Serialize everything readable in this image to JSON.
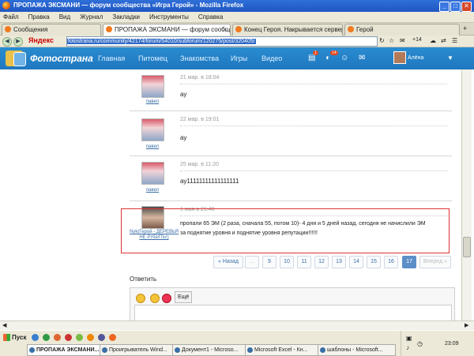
{
  "window": {
    "title": "ПРОПАЖА ЭКСМАНИ — форум сообщества «Игра Герой» - Mozilla Firefox",
    "min": "_",
    "max": "□",
    "close": "✕"
  },
  "menu": [
    "Файл",
    "Правка",
    "Вид",
    "Журнал",
    "Закладки",
    "Инструменты",
    "Справка"
  ],
  "tabs": [
    {
      "label": "Сообщения",
      "active": false
    },
    {
      "label": "ПРОПАЖА ЭКСМАНИ — форум сообще...",
      "active": true
    },
    {
      "label": "Конец Героя. Накрывается сервер —...",
      "active": false
    },
    {
      "label": "Герой",
      "active": false
    }
  ],
  "navbar": {
    "yandex": "Яндекс",
    "url_host": "fotostrana.ru",
    "url_path": "/community/42174/forum/54010/subforum/120275/post/320405/",
    "plus": "+14"
  },
  "site": {
    "brand": "Фотострана",
    "nav": [
      "Главная",
      "Питомец",
      "Знакомства",
      "Игры",
      "Видео"
    ],
    "badges": [
      "1",
      "14"
    ],
    "user": "Алёна"
  },
  "posts": [
    {
      "author": "павел",
      "date": "21 мар. в 18:04",
      "text": "ау"
    },
    {
      "author": "павел",
      "date": "22 мар. в 19:01",
      "text": "ау"
    },
    {
      "author": "павел",
      "date": "25 мар. в 11:20",
      "text": "ау11111111111111111"
    },
    {
      "author": "Nyk(Герой - ДЕРЕВЬЯ НЕ РУБИТЬ!)",
      "date": "1 мая в 21:46",
      "text1": "пропали 65 ЭМ (2 раза, сначала 55, потом 10)- 4 дня и 5 дней назад. сегодня не начислили ЭМ",
      "text2": "за поднятие уровня и поднятие уровня репутации!!!!!!"
    }
  ],
  "pagination": {
    "prev": "« Назад",
    "dots": "...",
    "pages": [
      "9",
      "10",
      "11",
      "12",
      "13",
      "14",
      "15",
      "16",
      "17"
    ],
    "current": "17",
    "next": "Вперед »"
  },
  "reply": {
    "label": "Ответить",
    "more": "Ещё"
  },
  "taskbar": {
    "start": "Пуск",
    "items": [
      {
        "label": "ПРОПАЖА ЭКСМАНИ...",
        "active": true
      },
      {
        "label": "Проигрыватель Wind...",
        "active": false
      },
      {
        "label": "Документ1 - Microso...",
        "active": false
      },
      {
        "label": "Microsoft Excel - Кн...",
        "active": false
      },
      {
        "label": "шаблоны - Microsoft...",
        "active": false
      }
    ],
    "clock": "23:09"
  }
}
